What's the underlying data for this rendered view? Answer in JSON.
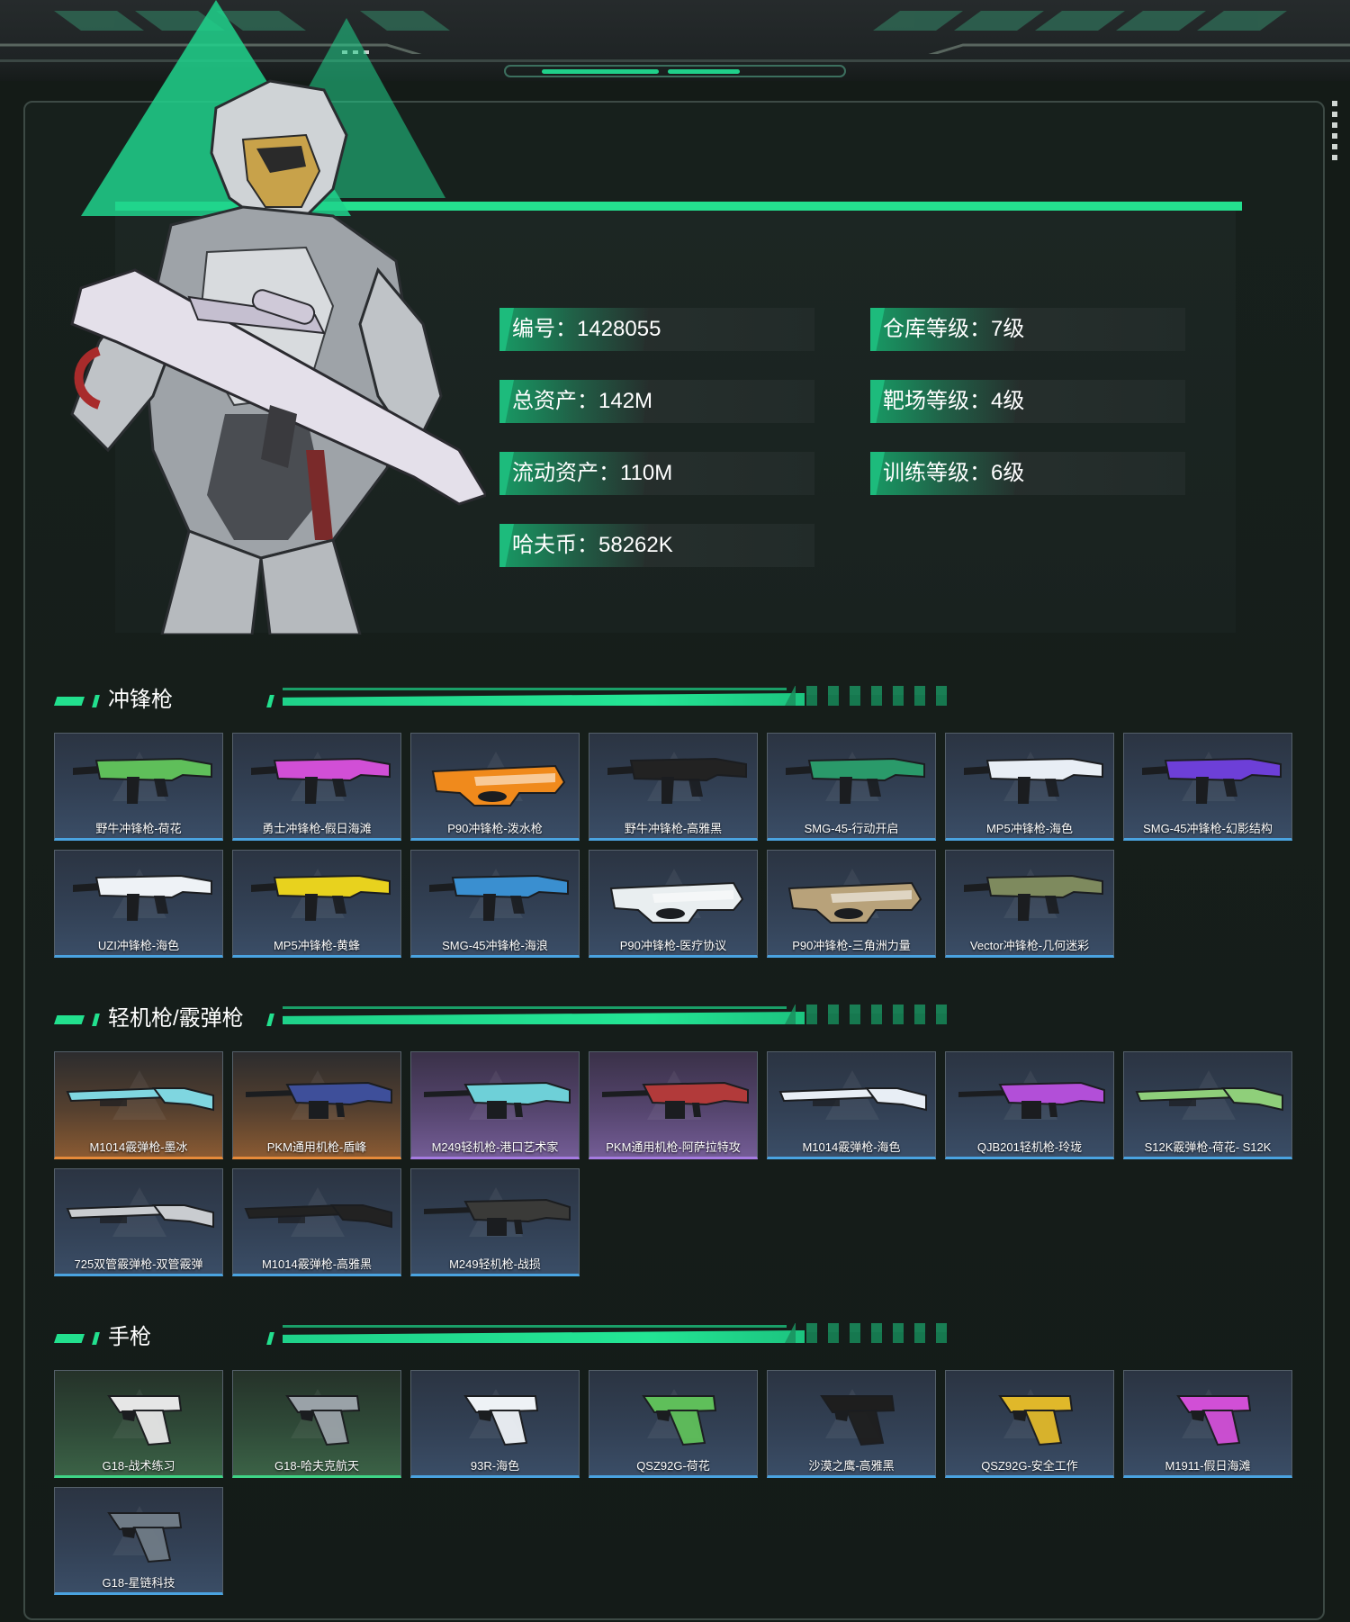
{
  "colors": {
    "accent": "#22e08e",
    "blue_rarity": "#4aa3e0",
    "orange_rarity": "#e58a3a",
    "purple_rarity": "#a57be0",
    "green_rarity": "#3fd486",
    "background": "#141b17"
  },
  "profile": {
    "character_image": "armored-soldier-with-rifle",
    "stats_left": [
      {
        "label": "编号：",
        "value": "1428055"
      },
      {
        "label": "总资产：",
        "value": "142M"
      },
      {
        "label": "流动资产：",
        "value": "110M"
      },
      {
        "label": "哈夫币：",
        "value": "58262K"
      }
    ],
    "stats_right": [
      {
        "label": "仓库等级：",
        "value": "7级"
      },
      {
        "label": "靶场等级：",
        "value": "4级"
      },
      {
        "label": "训练等级：",
        "value": "6级"
      }
    ]
  },
  "sections": [
    {
      "title": "冲锋枪",
      "items": [
        {
          "name": "野牛冲锋枪-荷花",
          "rarity": "blue",
          "icon": "smg-icon",
          "color": "#5fbf5a"
        },
        {
          "name": "勇士冲锋枪-假日海滩",
          "rarity": "blue",
          "icon": "smg-icon",
          "color": "#d14fd6"
        },
        {
          "name": "P90冲锋枪-泼水枪",
          "rarity": "blue",
          "icon": "p90-icon",
          "color": "#f08a1c"
        },
        {
          "name": "野牛冲锋枪-高雅黑",
          "rarity": "blue",
          "icon": "smg-icon",
          "color": "#222222"
        },
        {
          "name": "SMG-45-行动开启",
          "rarity": "blue",
          "icon": "smg-icon",
          "color": "#2a9a6a"
        },
        {
          "name": "MP5冲锋枪-海色",
          "rarity": "blue",
          "icon": "smg-icon",
          "color": "#e8eef5"
        },
        {
          "name": "SMG-45冲锋枪-幻影结构",
          "rarity": "blue",
          "icon": "smg-icon",
          "color": "#6d3fd8"
        },
        {
          "name": "UZI冲锋枪-海色",
          "rarity": "blue",
          "icon": "smg-icon",
          "color": "#eef2f6"
        },
        {
          "name": "MP5冲锋枪-黄蜂",
          "rarity": "blue",
          "icon": "smg-icon",
          "color": "#e8d21e"
        },
        {
          "name": "SMG-45冲锋枪-海浪",
          "rarity": "blue",
          "icon": "smg-icon",
          "color": "#3a8fd0"
        },
        {
          "name": "P90冲锋枪-医疗协议",
          "rarity": "blue",
          "icon": "p90-icon",
          "color": "#e9eef0"
        },
        {
          "name": "P90冲锋枪-三角洲力量",
          "rarity": "blue",
          "icon": "p90-icon",
          "color": "#b8a27a"
        },
        {
          "name": "Vector冲锋枪-几何迷彩",
          "rarity": "blue",
          "icon": "smg-icon",
          "color": "#7e8a5e"
        }
      ]
    },
    {
      "title": "轻机枪/霰弹枪",
      "items": [
        {
          "name": "M1014霰弹枪-墨冰",
          "rarity": "orange",
          "icon": "shotgun-icon",
          "color": "#7fd6e0"
        },
        {
          "name": "PKM通用机枪-盾峰",
          "rarity": "orange",
          "icon": "lmg-icon",
          "color": "#3e4f9a"
        },
        {
          "name": "M249轻机枪-港口艺术家",
          "rarity": "purple",
          "icon": "lmg-icon",
          "color": "#6ed0d8"
        },
        {
          "name": "PKM通用机枪-阿萨拉特攻",
          "rarity": "purple",
          "icon": "lmg-icon",
          "color": "#b23a3a"
        },
        {
          "name": "M1014霰弹枪-海色",
          "rarity": "blue",
          "icon": "shotgun-icon",
          "color": "#e8eef5"
        },
        {
          "name": "QJB201轻机枪-玲珑",
          "rarity": "blue",
          "icon": "lmg-icon",
          "color": "#b24fd8"
        },
        {
          "name": "S12K霰弹枪-荷花- S12K",
          "rarity": "blue",
          "icon": "shotgun-icon",
          "color": "#8fcf7a"
        },
        {
          "name": "725双管霰弹枪-双管霰弹",
          "rarity": "blue",
          "icon": "shotgun-icon",
          "color": "#c9ccd0"
        },
        {
          "name": "M1014霰弹枪-高雅黑",
          "rarity": "blue",
          "icon": "shotgun-icon",
          "color": "#222222"
        },
        {
          "name": "M249轻机枪-战损",
          "rarity": "blue",
          "icon": "lmg-icon",
          "color": "#3a3a38"
        }
      ]
    },
    {
      "title": "手枪",
      "items": [
        {
          "name": "G18-战术练习",
          "rarity": "green",
          "icon": "pistol-icon",
          "color": "#e6e6e6"
        },
        {
          "name": "G18-哈夫克航天",
          "rarity": "green",
          "icon": "pistol-icon",
          "color": "#9aa2a8"
        },
        {
          "name": "93R-海色",
          "rarity": "blue",
          "icon": "pistol-icon",
          "color": "#eef2f6"
        },
        {
          "name": "QSZ92G-荷花",
          "rarity": "blue",
          "icon": "pistol-icon",
          "color": "#5fbf5a"
        },
        {
          "name": "沙漠之鹰-高雅黑",
          "rarity": "blue",
          "icon": "pistol-icon",
          "color": "#1e1e1e"
        },
        {
          "name": "QSZ92G-安全工作",
          "rarity": "blue",
          "icon": "pistol-icon",
          "color": "#e0b82a"
        },
        {
          "name": "M1911-假日海滩",
          "rarity": "blue",
          "icon": "pistol-icon",
          "color": "#d14fd6"
        },
        {
          "name": "G18-星链科技",
          "rarity": "blue",
          "icon": "pistol-icon",
          "color": "#6f7b86"
        }
      ]
    }
  ]
}
